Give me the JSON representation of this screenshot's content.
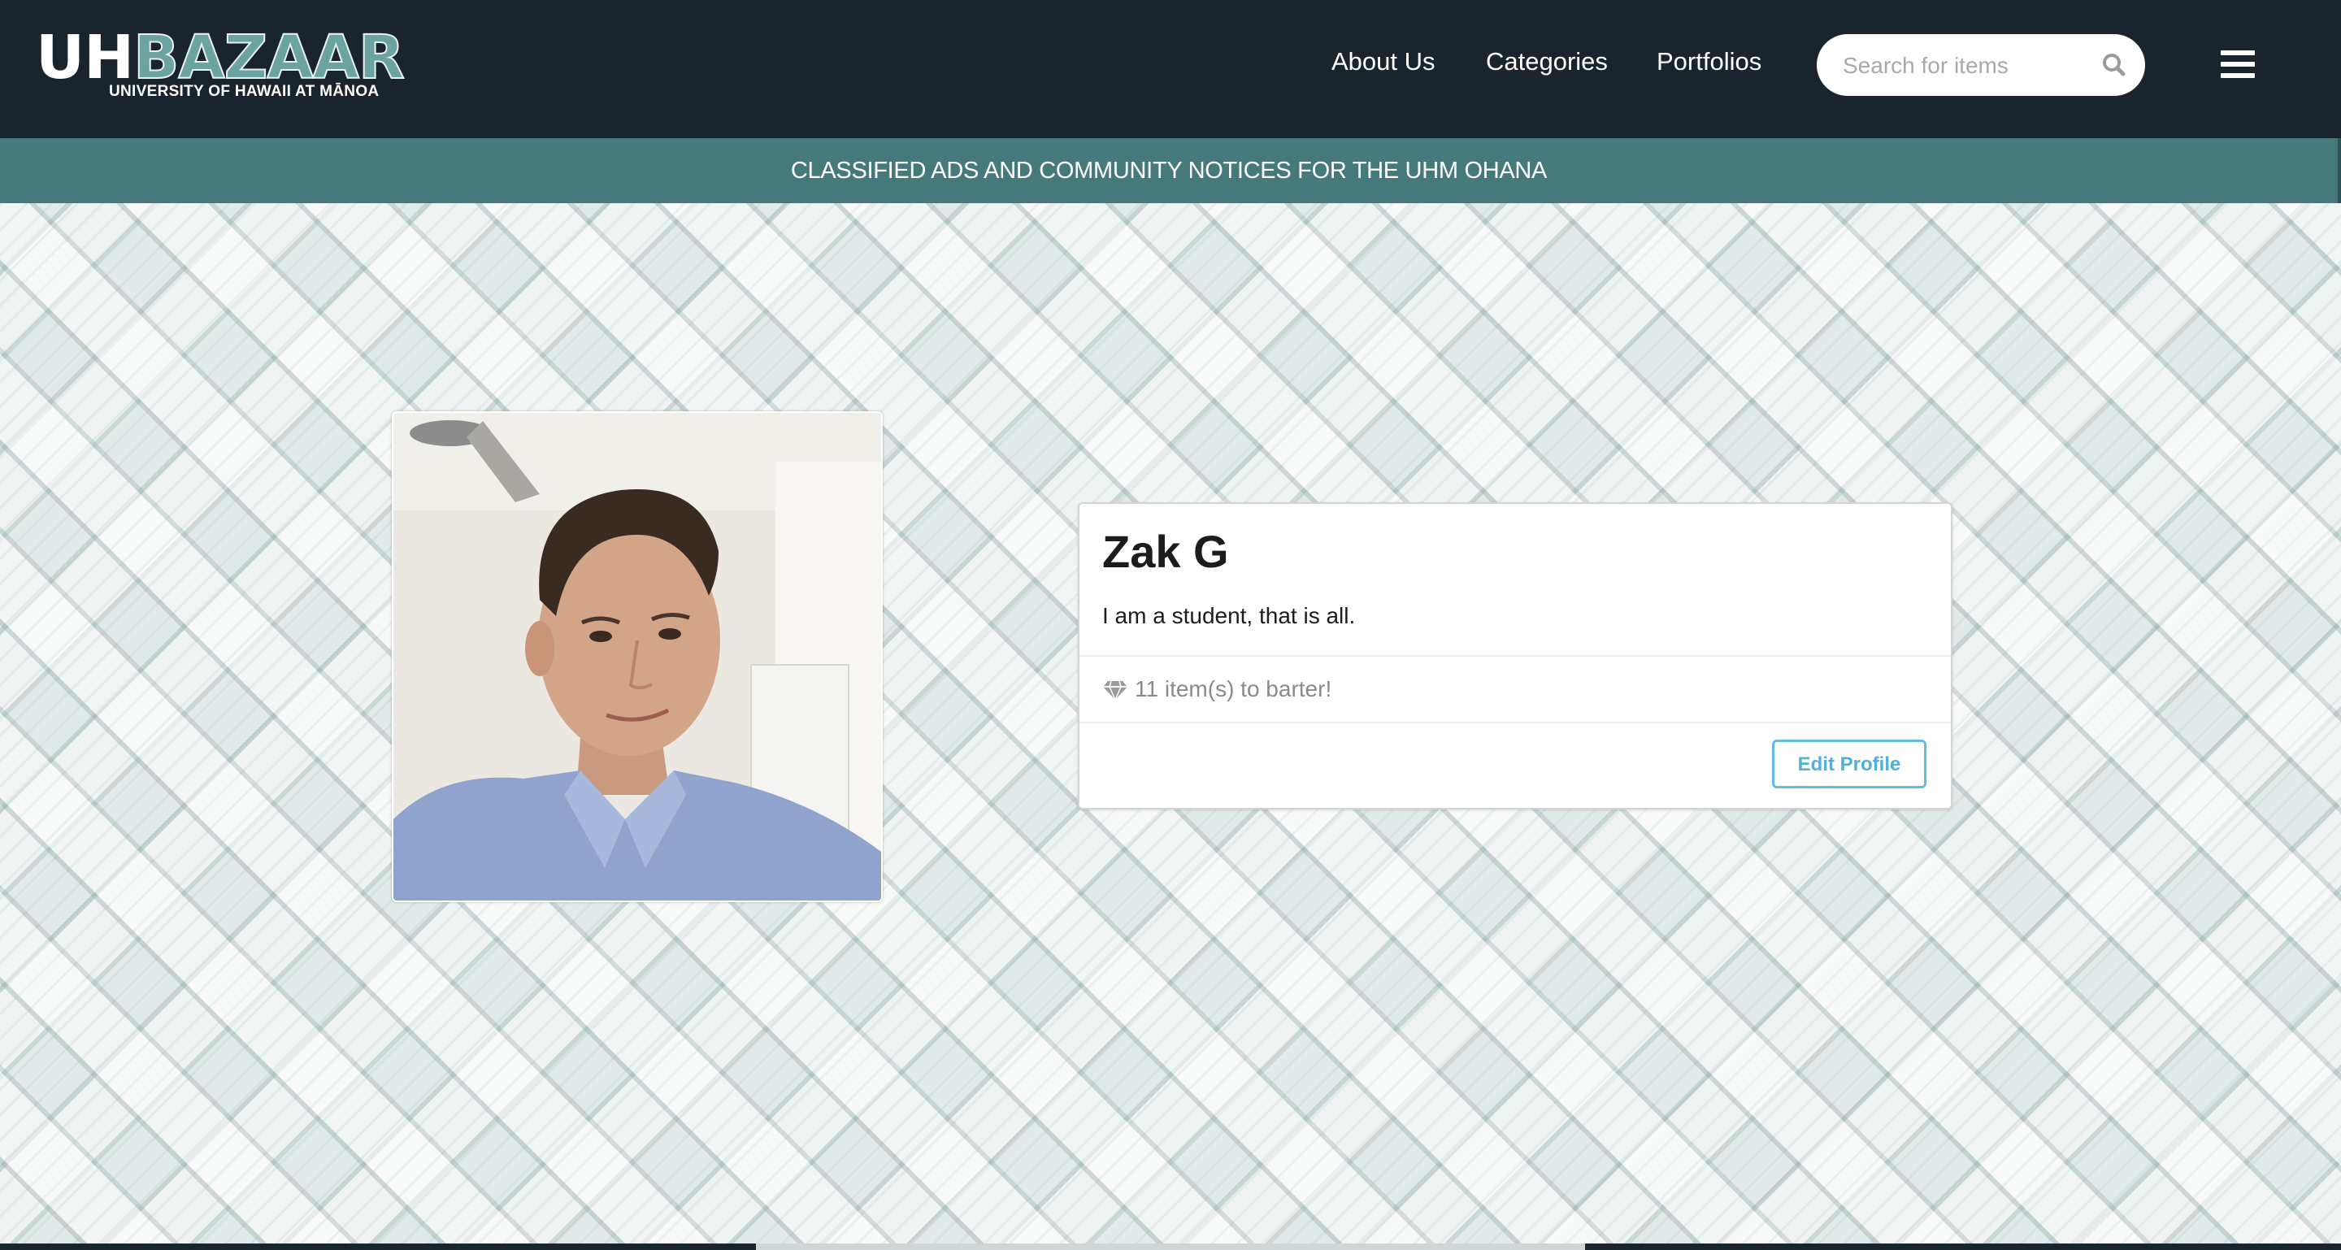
{
  "header": {
    "logo": {
      "primary": "UH",
      "secondary": "BAZAAR",
      "subtitle": "UNIVERSITY OF HAWAII AT MĀNOA"
    },
    "nav": {
      "about": "About Us",
      "categories": "Categories",
      "portfolios": "Portfolios"
    },
    "search": {
      "placeholder": "Search for items",
      "icon": "search-icon"
    },
    "menu_icon": "hamburger-menu-icon",
    "colors": {
      "background": "#1a242c",
      "logo_accent": "#6aa3a0"
    }
  },
  "banner": {
    "text": "CLASSIFIED ADS AND COMMUNITY NOTICES FOR THE UHM OHANA",
    "color": "#46797a"
  },
  "profile": {
    "name": "Zak G",
    "bio": "I am a student, that is all.",
    "items_text": "11 item(s) to barter!",
    "items_icon": "diamond-icon",
    "edit_label": "Edit Profile",
    "edit_color": "#65bae6"
  }
}
